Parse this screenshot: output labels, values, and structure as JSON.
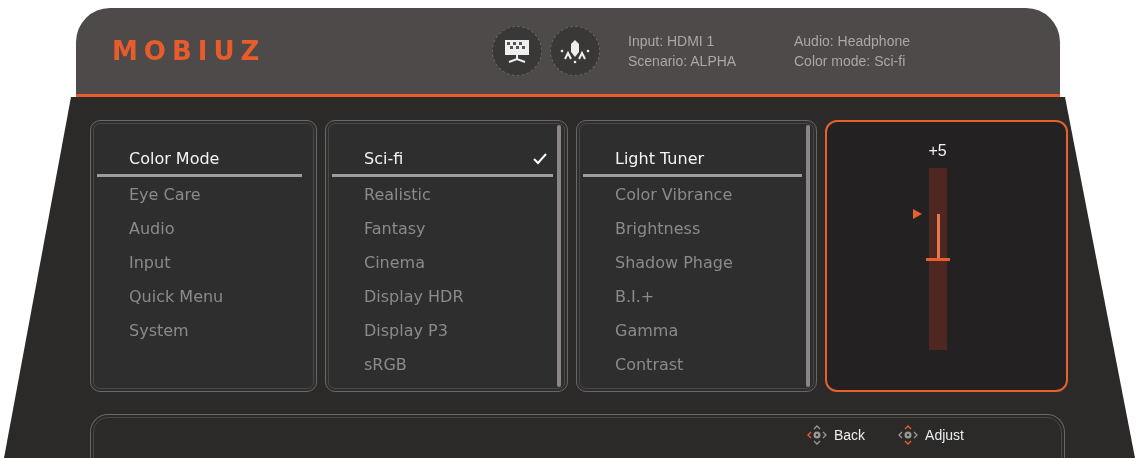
{
  "header": {
    "logo": "MOBIUZ",
    "info": [
      "Input: HDMI 1",
      "Scenario: ALPHA",
      "Audio: Headphone",
      "Color mode: Sci-fi"
    ]
  },
  "menus": [
    {
      "items": [
        {
          "label": "Color Mode",
          "selected": true,
          "checked": false
        },
        {
          "label": "Eye Care",
          "selected": false,
          "checked": false
        },
        {
          "label": "Audio",
          "selected": false,
          "checked": false
        },
        {
          "label": "Input",
          "selected": false,
          "checked": false
        },
        {
          "label": "Quick Menu",
          "selected": false,
          "checked": false
        },
        {
          "label": "System",
          "selected": false,
          "checked": false
        }
      ],
      "scrollbar": false
    },
    {
      "items": [
        {
          "label": "Sci-fi",
          "selected": true,
          "checked": true
        },
        {
          "label": "Realistic",
          "selected": false,
          "checked": false
        },
        {
          "label": "Fantasy",
          "selected": false,
          "checked": false
        },
        {
          "label": "Cinema",
          "selected": false,
          "checked": false
        },
        {
          "label": "Display HDR",
          "selected": false,
          "checked": false
        },
        {
          "label": "Display P3",
          "selected": false,
          "checked": false
        },
        {
          "label": "sRGB",
          "selected": false,
          "checked": false
        }
      ],
      "scrollbar": true
    },
    {
      "items": [
        {
          "label": "Light Tuner",
          "selected": true,
          "checked": false
        },
        {
          "label": "Color Vibrance",
          "selected": false,
          "checked": false
        },
        {
          "label": "Brightness",
          "selected": false,
          "checked": false
        },
        {
          "label": "Shadow Phage",
          "selected": false,
          "checked": false
        },
        {
          "label": "B.I.+",
          "selected": false,
          "checked": false
        },
        {
          "label": "Gamma",
          "selected": false,
          "checked": false
        },
        {
          "label": "Contrast",
          "selected": false,
          "checked": false
        }
      ],
      "scrollbar": true
    }
  ],
  "slider": {
    "reading": "+5",
    "level": 0.75
  },
  "footer": {
    "hints": [
      {
        "label": "Back",
        "kind": "left"
      },
      {
        "label": "Adjust",
        "kind": "updown"
      }
    ]
  }
}
